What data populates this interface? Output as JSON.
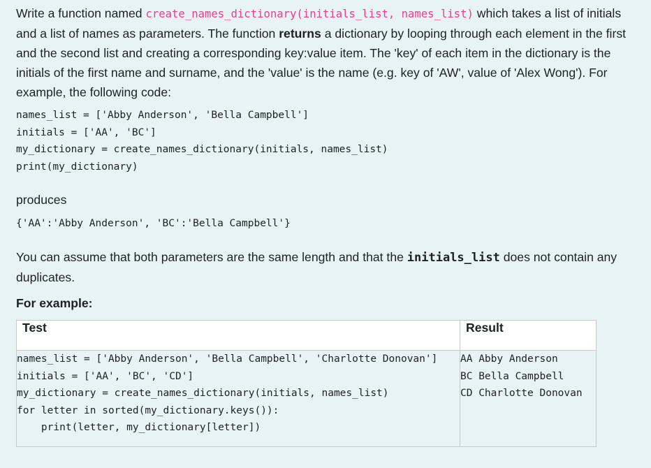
{
  "intro": {
    "t1": "Write a function named ",
    "fn_sig": "create_names_dictionary(initials_list, names_list)",
    "t2": " which takes a list of initials and a list of names as parameters. The function ",
    "returns_word": "returns",
    "t3": " a dictionary by looping through each element in the first and the second list and creating a corresponding key:value item. The 'key' of each item in the dictionary is the initials of the first name and surname, and the 'value' is the name (e.g. key of 'AW', value of 'Alex Wong'). For example, the following code:"
  },
  "example_code": [
    "names_list = ['Abby Anderson', 'Bella Campbell']",
    "initials = ['AA', 'BC']",
    "my_dictionary = create_names_dictionary(initials, names_list)",
    "print(my_dictionary)"
  ],
  "produces_label": "produces",
  "produces_output": "{'AA':'Abby Anderson', 'BC':'Bella Campbell'}",
  "assume": {
    "t1": "You can assume that both parameters are the same length and that the ",
    "code": "initials_list",
    "t2": " does not contain any duplicates."
  },
  "for_example_label": "For example:",
  "table": {
    "headers": {
      "test": "Test",
      "result": "Result"
    },
    "test_lines": [
      "names_list = ['Abby Anderson', 'Bella Campbell', 'Charlotte Donovan']",
      "initials = ['AA', 'BC', 'CD']",
      "my_dictionary = create_names_dictionary(initials, names_list)",
      "for letter in sorted(my_dictionary.keys()):",
      "    print(letter, my_dictionary[letter])"
    ],
    "result_lines": [
      "AA Abby Anderson",
      "BC Bella Campbell",
      "CD Charlotte Donovan"
    ]
  }
}
